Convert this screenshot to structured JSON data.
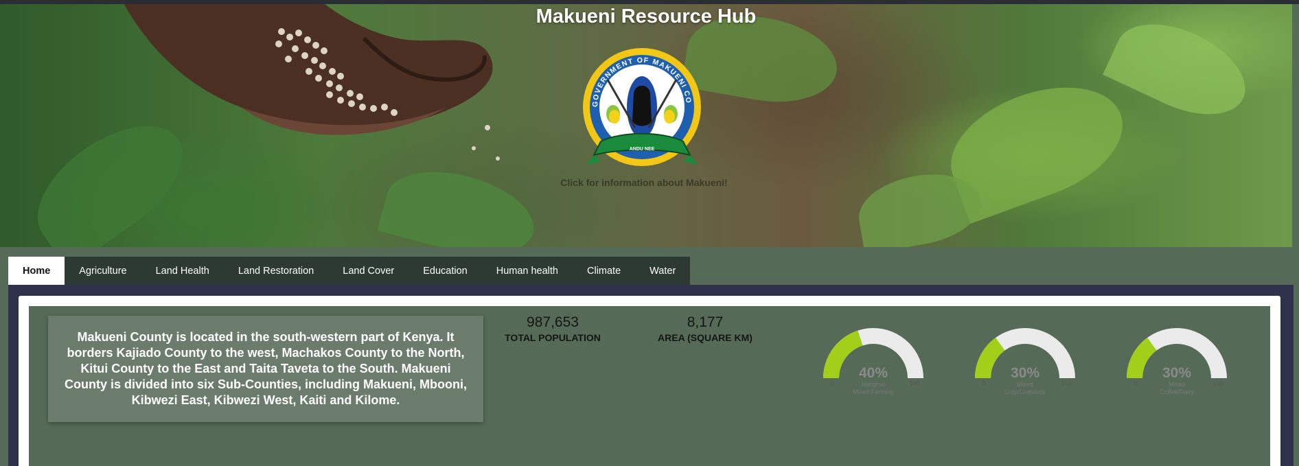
{
  "header": {
    "title": "Makueni Resource Hub",
    "caption": "Click for information about Makueni!",
    "seal_text": "GOVERNMENT OF MAKUENI COUNTY",
    "seal_motto": "ANDU NEE"
  },
  "tabs": [
    {
      "label": "Home",
      "active": true
    },
    {
      "label": "Agriculture"
    },
    {
      "label": "Land Health"
    },
    {
      "label": "Land Restoration"
    },
    {
      "label": "Land Cover"
    },
    {
      "label": "Education"
    },
    {
      "label": "Human health"
    },
    {
      "label": "Climate"
    },
    {
      "label": "Water"
    }
  ],
  "intro": {
    "text": "Makueni County is located in the south-western part of Kenya. It borders Kajiado County to the west, Machakos County to the North, Kitui County to the East and Taita Taveta to the South. Makueni County is divided into six Sub-Counties, including Makueni, Mbooni, Kibwezi East, Kibwezi West, Kaiti and Kilome."
  },
  "stats": {
    "population": {
      "value": "987,653",
      "label": "TOTAL POPULATION"
    },
    "area": {
      "value": "8,177",
      "label": "AREA (SQUARE KM)"
    }
  },
  "gauges": [
    {
      "value": 40,
      "display": "40%",
      "min": "0",
      "max": "100",
      "label_line1": "Marginal",
      "label_line2": "Mixed Farming"
    },
    {
      "value": 30,
      "display": "30%",
      "min": "0",
      "max": "100",
      "label_line1": "Mixed",
      "label_line2": "Crop/Livestock"
    },
    {
      "value": 30,
      "display": "30%",
      "min": "0",
      "max": "100",
      "label_line1": "Mixed",
      "label_line2": "Coffee/Dairy"
    }
  ],
  "colors": {
    "gauge_fill": "#a2d01a",
    "gauge_track": "#ebebeb",
    "gauge_text": "#8a8a8a"
  }
}
